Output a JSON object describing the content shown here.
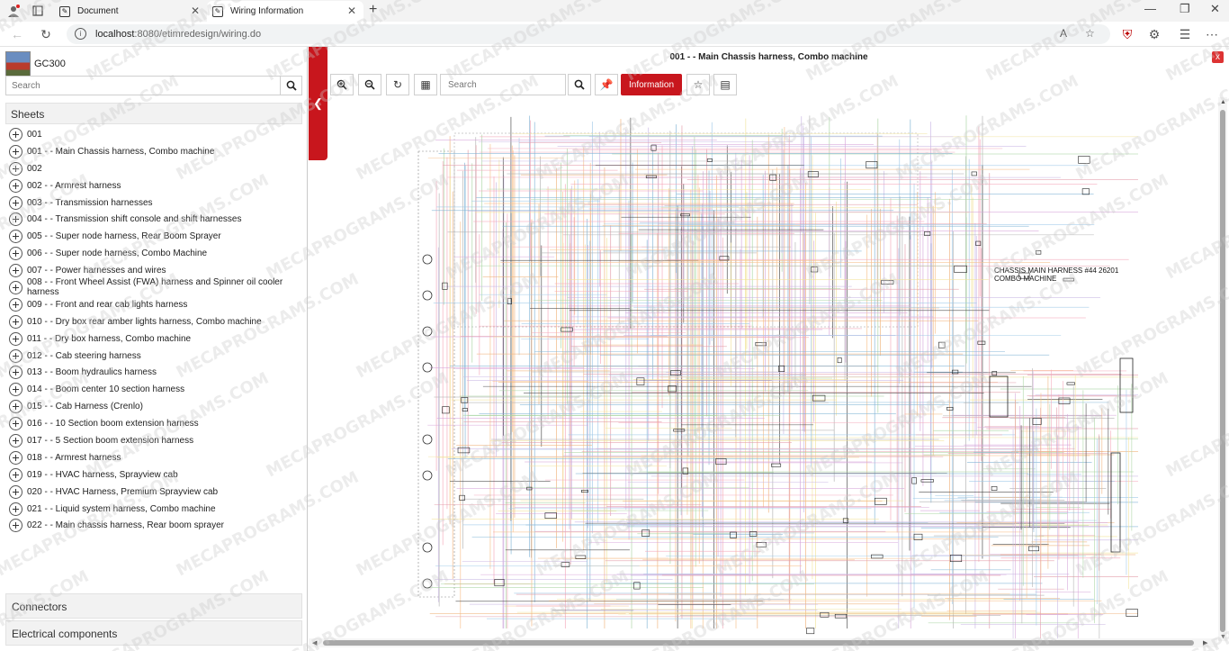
{
  "browser": {
    "tabs": [
      {
        "title": "Document"
      },
      {
        "title": "Wiring Information"
      }
    ],
    "url_host": "localhost",
    "url_rest": ":8080/etimredesign/wiring.do"
  },
  "sidebar": {
    "model_name": "GC300",
    "search_placeholder": "Search",
    "sheets_title": "Sheets",
    "sheets": [
      "001",
      "001 - - Main Chassis harness, Combo machine",
      "002",
      "002 - - Armrest harness",
      "003 - - Transmission harnesses",
      "004 - - Transmission shift console and shift harnesses",
      "005 - - Super node harness, Rear Boom Sprayer",
      "006 - - Super node harness, Combo Machine",
      "007 - - Power harnesses and wires",
      "008 - - Front Wheel Assist (FWA) harness and Spinner oil cooler harness",
      "009 - - Front and rear cab lights harness",
      "010 - - Dry box rear amber lights harness, Combo machine",
      "011 - - Dry box harness, Combo machine",
      "012 - - Cab steering harness",
      "013 - - Boom hydraulics harness",
      "014 - - Boom center 10 section harness",
      "015 - - Cab Harness (Crenlo)",
      "016 - - 10 Section boom extension harness",
      "017 - - 5 Section boom extension harness",
      "018 - - Armrest harness",
      "019 - - HVAC harness, Sprayview cab",
      "020 - - HVAC Harness, Premium Sprayview cab",
      "021 - - Liquid system harness, Combo machine",
      "022 - - Main chassis harness, Rear boom sprayer"
    ],
    "connectors_label": "Connectors",
    "components_label": "Electrical components"
  },
  "diagram": {
    "title": "001 - - Main Chassis harness, Combo machine",
    "search_placeholder": "Search",
    "info_button": "Information",
    "caption_line1": "CHASSIS MAIN HARNESS #44 26201",
    "caption_line2": "COMBO MACHINE"
  },
  "watermark": "MECAPROGRAMS.COM"
}
